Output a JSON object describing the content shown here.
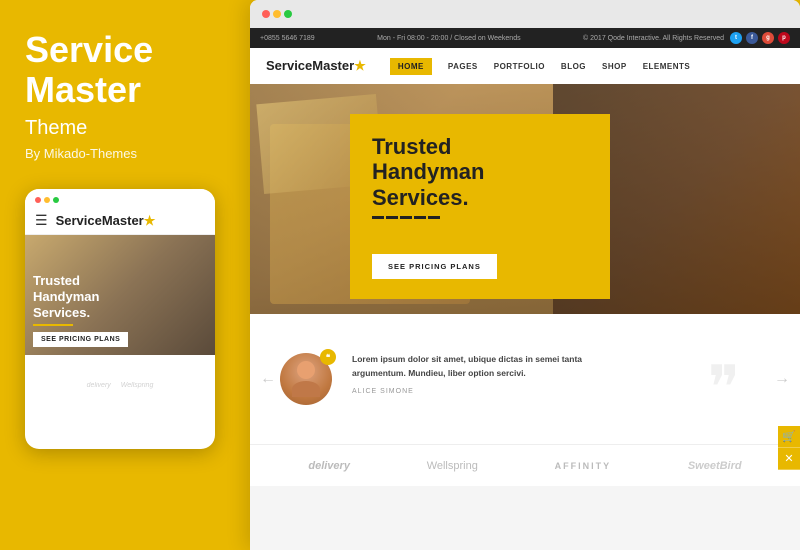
{
  "left": {
    "title_line1": "Service",
    "title_line2": "Master",
    "subtitle": "Theme",
    "author": "By Mikado-Themes",
    "mobile_logo": "ServiceMaster",
    "mobile_logo_star": "★",
    "mobile_hero_title": "Trusted\nHandyman\nServices.",
    "mobile_cta": "SEE PRICING PLANS"
  },
  "browser": {
    "dots": [
      "red",
      "#f0b429",
      "#2ecc40"
    ]
  },
  "site": {
    "topbar_left": "+0855 5646 7189",
    "topbar_center": "Mon - Fri 08:00 - 20:00 / Closed on Weekends",
    "topbar_right": "© 2017 Qode Interactive. All Rights Reserved",
    "nav": {
      "logo": "ServiceMaster",
      "logo_star": "★",
      "items": [
        "HOME",
        "PAGES",
        "PORTFOLIO",
        "BLOG",
        "SHOP",
        "ELEMENTS"
      ]
    },
    "hero": {
      "title": "Trusted\nHandyman\nServices.",
      "cta": "SEE PRICING PLANS"
    },
    "testimonial": {
      "avatar_badge": "❝",
      "quote_mark": "❞",
      "text": "Lorem ipsum dolor sit amet, ubique dictas in semei tanta argumentum. Mundieu, liber option sercivi.",
      "author": "ALICE SIMONE"
    },
    "brands": [
      "delivery",
      "Wellspring",
      "AFFINITY",
      "SweetBird"
    ]
  }
}
